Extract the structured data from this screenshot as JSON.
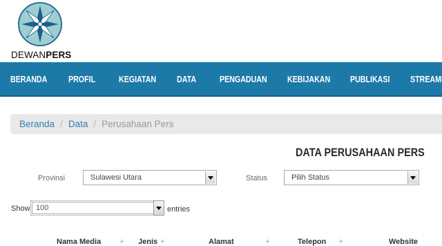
{
  "brand": {
    "logo_word_normal": "DEWAN",
    "logo_word_bold": "PERS"
  },
  "nav": {
    "items": [
      "BERANDA",
      "PROFIL",
      "KEGIATAN",
      "DATA",
      "PENGADUAN",
      "KEBIJAKAN",
      "PUBLIKASI",
      "STREAMI"
    ]
  },
  "breadcrumb": {
    "home": "Beranda",
    "section": "Data",
    "current": "Perusahaan Pers",
    "separator": "/"
  },
  "page": {
    "title": "DATA PERUSAHAAN PERS"
  },
  "filters": {
    "provinsi_label": "Provinsi",
    "provinsi_value": "Sulawesi Utara",
    "status_label": "Status",
    "status_value": "Pilih Status"
  },
  "table_controls": {
    "show_label": "Show",
    "length_value": "100",
    "entries_label": "entries"
  },
  "table": {
    "columns": [
      "Nama Media",
      "Jenis",
      "Alamat",
      "Telepon",
      "Website"
    ]
  },
  "colors": {
    "nav_bg": "#1d7aa8",
    "link": "#2f7fb5",
    "breadcrumb_bg": "#e9e9e9"
  }
}
